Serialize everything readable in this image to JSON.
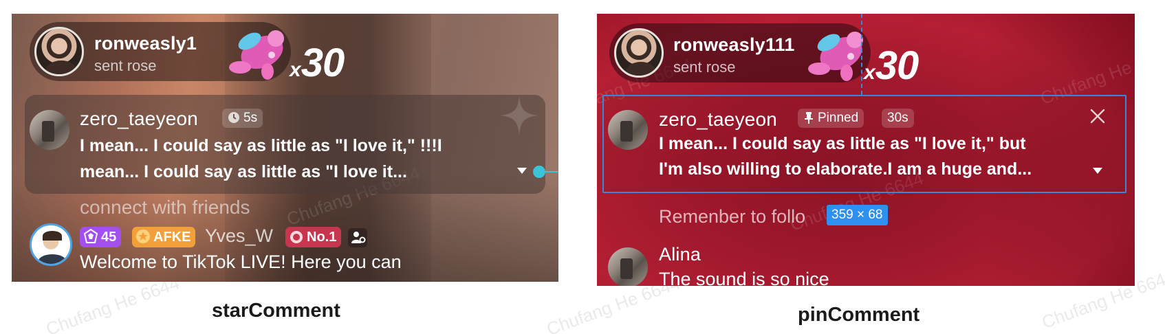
{
  "star_comment_demo": {
    "caption": "starComment",
    "gift": {
      "username": "ronweasly1",
      "action": "sent rose",
      "multiplier_prefix": "x",
      "count": "30"
    },
    "comment": {
      "username": "zero_taeyeon",
      "time_chip": "5s",
      "line1": "I mean... I could say as little as \"I love it,\" !!!I",
      "line2": "mean... I could say as little as \"I love it..."
    },
    "faded_line": "connect with friends",
    "next_comment": {
      "level_badge": "45",
      "fan_badge": "AFKE",
      "username": "Yves_W",
      "rank_badge": "No.1",
      "text": "Welcome to TikTok LIVE! Here you can"
    }
  },
  "pin_comment_demo": {
    "caption": "pinComment",
    "gift": {
      "username": "ronweasly111",
      "action": "sent rose",
      "multiplier_prefix": "x",
      "count": "30"
    },
    "comment": {
      "username": "zero_taeyeon",
      "pinned_chip": "Pinned",
      "time_chip": "30s",
      "line1": "I mean... I could say as little as \"I love it,\" but",
      "line2": "I'm also willing to elaborate.I am a huge and..."
    },
    "faded_line": "Remenber to follo",
    "size_tag": "359 × 68",
    "next_comment": {
      "username": "Alina",
      "text": "The sound is so nice"
    }
  },
  "watermark": "Chufang He 6644",
  "colors": {
    "selection": "#3a87d8",
    "handle": "#39c4d8",
    "size_tag": "#2e90f0",
    "level_badge": "#a34ff0",
    "fan_badge": "#f2a03a",
    "rank_badge": "#c8354e"
  }
}
